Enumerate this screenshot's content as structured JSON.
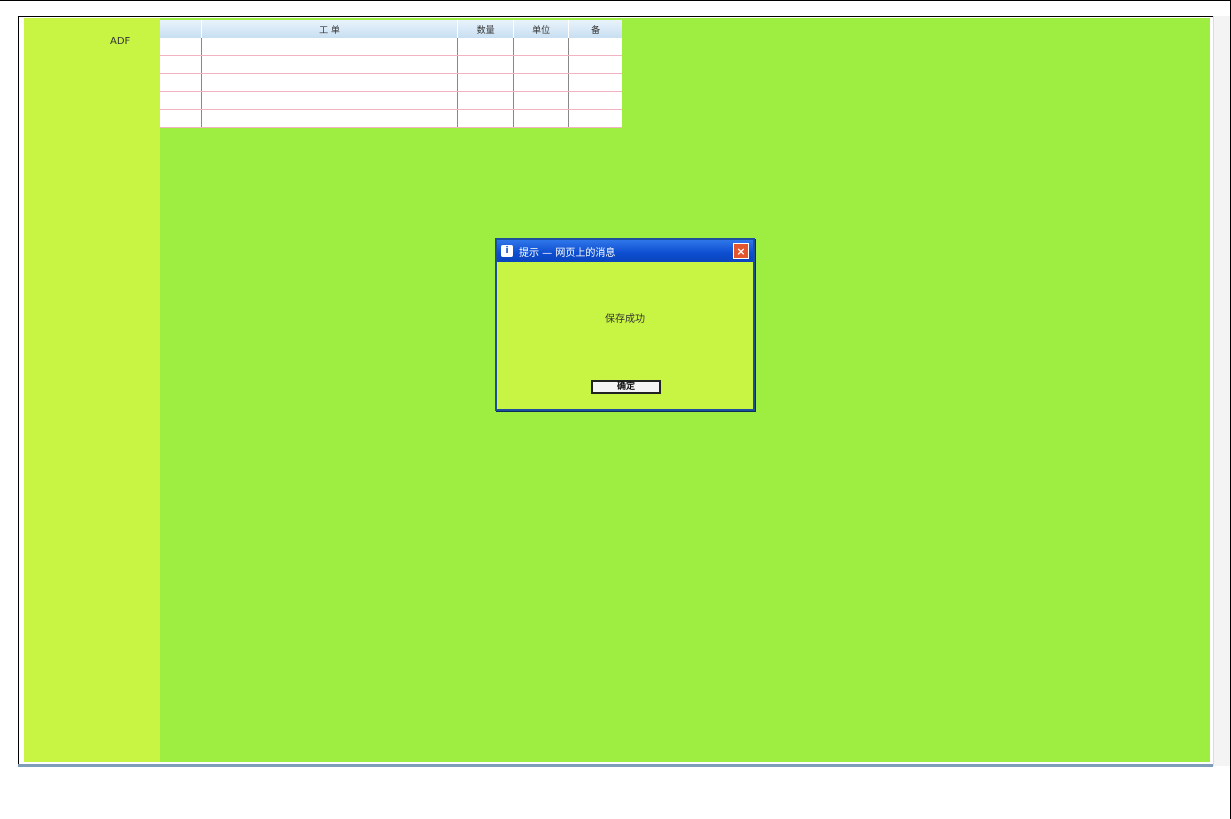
{
  "left_panel": {
    "label": "ADF"
  },
  "grid": {
    "headers": [
      "工 单",
      "数量",
      "单位",
      "备"
    ],
    "row_count": 5
  },
  "dialog": {
    "title": "提示 — 网页上的消息",
    "message": "保存成功",
    "ok_label": "确定",
    "close_icon": "close-icon",
    "app_icon": "info-icon"
  },
  "colors": {
    "left_panel": "#c8f544",
    "main_area": "#9eee42",
    "dialog_titlebar": "#0d4ed0"
  }
}
